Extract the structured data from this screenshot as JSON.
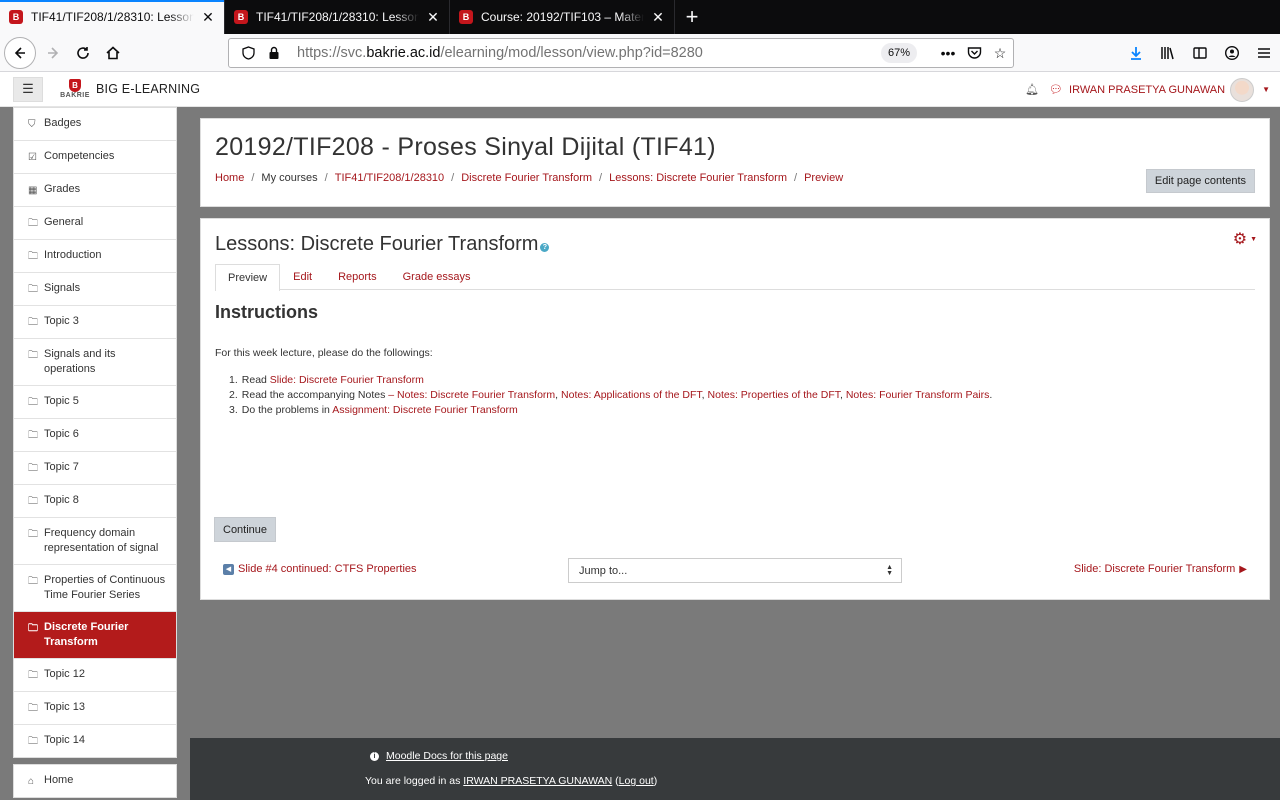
{
  "browser": {
    "tabs": [
      {
        "title": "TIF41/TIF208/1/28310: Lesson",
        "active": true
      },
      {
        "title": "TIF41/TIF208/1/28310: Lesson",
        "active": false
      },
      {
        "title": "Course: 20192/TIF103 – Mater",
        "active": false
      }
    ],
    "url_prefix": "https://svc.",
    "url_domain": "bakrie.ac.id",
    "url_suffix": "/elearning/mod/lesson/view.php?id=8280",
    "zoom": "67%"
  },
  "header": {
    "logo_text": "BAKRIE",
    "site_name": "BIG E-LEARNING",
    "user_name": "IRWAN PRASETYA GUNAWAN"
  },
  "sidebar": {
    "items": [
      {
        "label": "Badges",
        "icon": "shield-icon"
      },
      {
        "label": "Competencies",
        "icon": "check-square-icon"
      },
      {
        "label": "Grades",
        "icon": "table-icon"
      },
      {
        "label": "General",
        "icon": "folder-icon"
      },
      {
        "label": "Introduction",
        "icon": "folder-icon"
      },
      {
        "label": "Signals",
        "icon": "folder-icon"
      },
      {
        "label": "Topic 3",
        "icon": "folder-icon"
      },
      {
        "label": "Signals and its operations",
        "icon": "folder-icon"
      },
      {
        "label": "Topic 5",
        "icon": "folder-icon"
      },
      {
        "label": "Topic 6",
        "icon": "folder-icon"
      },
      {
        "label": "Topic 7",
        "icon": "folder-icon"
      },
      {
        "label": "Topic 8",
        "icon": "folder-icon"
      },
      {
        "label": "Frequency domain representation of signal",
        "icon": "folder-icon"
      },
      {
        "label": "Properties of Continuous Time Fourier Series",
        "icon": "folder-icon"
      },
      {
        "label": "Discrete Fourier Transform",
        "icon": "folder-icon",
        "active": true
      },
      {
        "label": "Topic 12",
        "icon": "folder-icon"
      },
      {
        "label": "Topic 13",
        "icon": "folder-icon"
      },
      {
        "label": "Topic 14",
        "icon": "folder-icon"
      }
    ],
    "home_label": "Home"
  },
  "page": {
    "title": "20192/TIF208 - Proses Sinyal Dijital (TIF41)",
    "breadcrumbs": [
      {
        "label": "Home",
        "link": true
      },
      {
        "label": "My courses",
        "link": false
      },
      {
        "label": "TIF41/TIF208/1/28310",
        "link": true
      },
      {
        "label": "Discrete Fourier Transform",
        "link": true
      },
      {
        "label": "Lessons: Discrete Fourier Transform",
        "link": true
      },
      {
        "label": "Preview",
        "link": true
      }
    ],
    "edit_button": "Edit page contents"
  },
  "lesson": {
    "title": "Lessons: Discrete Fourier Transform",
    "tabs": [
      "Preview",
      "Edit",
      "Reports",
      "Grade essays"
    ],
    "heading": "Instructions",
    "intro": "For this week lecture, please do the followings:",
    "steps": [
      {
        "num": "1.",
        "parts": [
          {
            "text": "Read "
          },
          {
            "text": "Slide: Discrete Fourier Transform",
            "link": true
          }
        ]
      },
      {
        "num": "2.",
        "parts": [
          {
            "text": "Read the accompanying Notes "
          },
          {
            "text": "– Notes: Discrete Fourier Transform",
            "link": true
          },
          {
            "text": ", "
          },
          {
            "text": "Notes: Applications of the DFT",
            "link": true
          },
          {
            "text": ", "
          },
          {
            "text": "Notes: Properties of the DFT",
            "link": true
          },
          {
            "text": ", "
          },
          {
            "text": "Notes: Fourier Transform Pairs",
            "link": true
          },
          {
            "text": "."
          }
        ]
      },
      {
        "num": "3.",
        "parts": [
          {
            "text": "Do the problems in "
          },
          {
            "text": "Assignment: Discrete Fourier Transform",
            "link": true
          }
        ]
      }
    ],
    "continue_button": "Continue",
    "prev_link": "Slide #4 continued: CTFS Properties",
    "jump_placeholder": "Jump to...",
    "next_link": "Slide: Discrete Fourier Transform"
  },
  "footer": {
    "docs_link": "Moodle Docs for this page",
    "logged_prefix": "You are logged in as ",
    "logged_user": "IRWAN PRASETYA GUNAWAN",
    "logout_open": " (",
    "logout_label": "Log out",
    "logout_close": ")"
  },
  "colors": {
    "accent": "#a5171c",
    "active_section": "#b31b1b",
    "footer_bg": "#373a3c",
    "page_bg": "#7a7a7a"
  }
}
